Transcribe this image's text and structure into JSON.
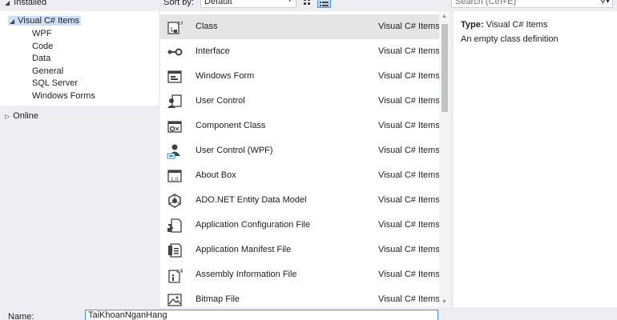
{
  "top": {
    "installed_label": "Installed",
    "sort_by_label": "Sort by:",
    "sort_value": "Default",
    "search_placeholder": "Search (Ctrl+E)"
  },
  "tree": {
    "visual_csharp": "Visual C# Items",
    "children": [
      "WPF",
      "Code",
      "Data",
      "General",
      "SQL Server",
      "Windows Forms"
    ],
    "online": "Online"
  },
  "templates": [
    {
      "name": "Class",
      "category": "Visual C# Items",
      "icon": "class-icon"
    },
    {
      "name": "Interface",
      "category": "Visual C# Items",
      "icon": "interface-icon"
    },
    {
      "name": "Windows Form",
      "category": "Visual C# Items",
      "icon": "windows-form-icon"
    },
    {
      "name": "User Control",
      "category": "Visual C# Items",
      "icon": "user-control-icon"
    },
    {
      "name": "Component Class",
      "category": "Visual C# Items",
      "icon": "component-class-icon"
    },
    {
      "name": "User Control (WPF)",
      "category": "Visual C# Items",
      "icon": "user-control-wpf-icon"
    },
    {
      "name": "About Box",
      "category": "Visual C# Items",
      "icon": "about-box-icon"
    },
    {
      "name": "ADO.NET Entity Data Model",
      "category": "Visual C# Items",
      "icon": "entity-data-model-icon"
    },
    {
      "name": "Application Configuration File",
      "category": "Visual C# Items",
      "icon": "config-file-icon"
    },
    {
      "name": "Application Manifest File",
      "category": "Visual C# Items",
      "icon": "manifest-file-icon"
    },
    {
      "name": "Assembly Information File",
      "category": "Visual C# Items",
      "icon": "assembly-info-icon"
    },
    {
      "name": "Bitmap File",
      "category": "Visual C# Items",
      "icon": "bitmap-file-icon"
    }
  ],
  "description": {
    "type_label": "Type:",
    "type_value": "Visual C# Items",
    "text": "An empty class definition"
  },
  "name_row": {
    "label": "Name:",
    "value": "TaiKhoanNganHang"
  },
  "colors": {
    "accent": "#3399ff",
    "selection": "#cce0f7"
  }
}
